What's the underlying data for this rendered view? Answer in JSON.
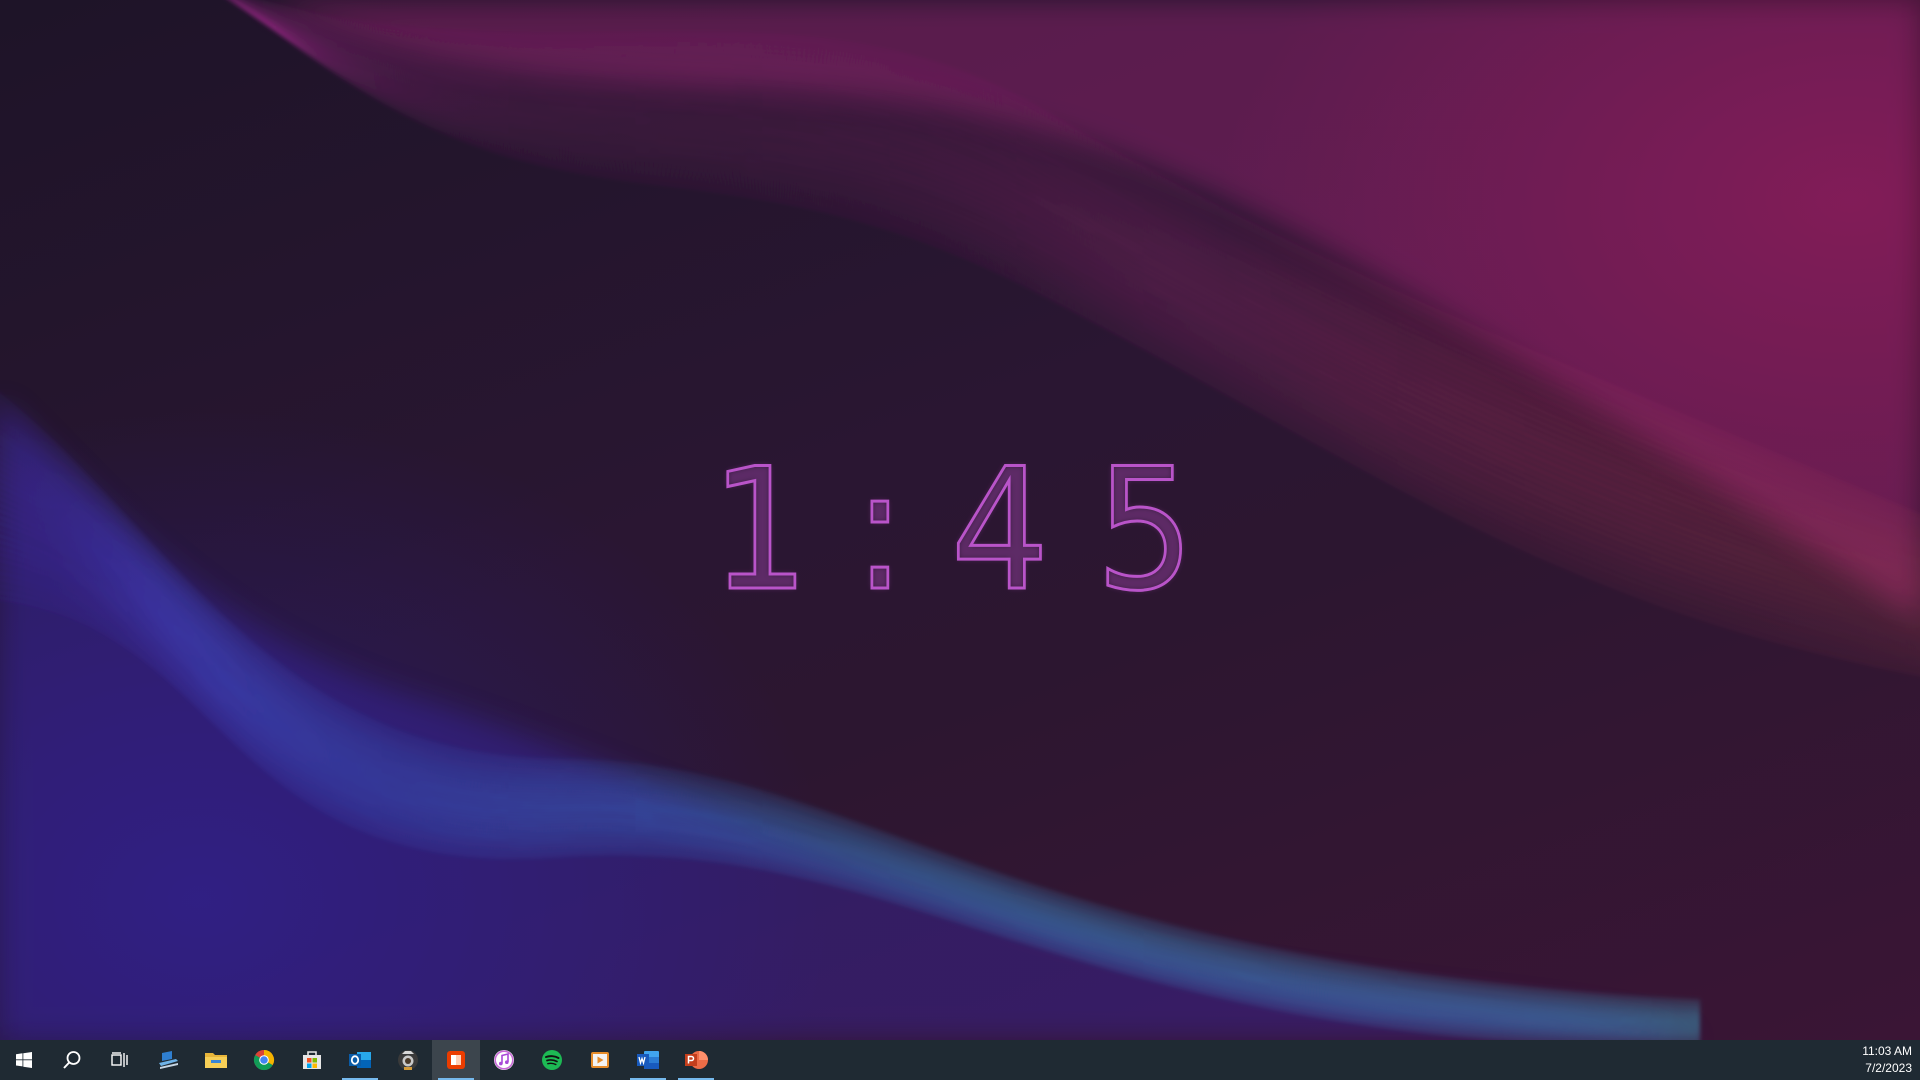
{
  "screen": {
    "clock": {
      "h": "1",
      "sep": ":",
      "m1": "4",
      "m2": "5"
    }
  },
  "colors": {
    "clock": "#c65ad6",
    "taskbar": "#1f2a33",
    "active_indicator": "#76b9ed"
  },
  "taskbar": {
    "items": [
      {
        "name": "start",
        "icon": "windows-logo-icon"
      },
      {
        "name": "search",
        "icon": "search-icon"
      },
      {
        "name": "task-view",
        "icon": "task-view-icon"
      },
      {
        "name": "app-1",
        "icon": "desk-app-icon"
      },
      {
        "name": "file-explorer",
        "icon": "folder-icon"
      },
      {
        "name": "chrome",
        "icon": "chrome-icon"
      },
      {
        "name": "store",
        "icon": "store-icon"
      },
      {
        "name": "outlook",
        "icon": "outlook-icon",
        "active": true
      },
      {
        "name": "camera-app",
        "icon": "camera-icon"
      },
      {
        "name": "office",
        "icon": "office-icon",
        "selected": true
      },
      {
        "name": "itunes",
        "icon": "music-note-icon"
      },
      {
        "name": "spotify",
        "icon": "spotify-icon"
      },
      {
        "name": "media-player",
        "icon": "play-icon"
      },
      {
        "name": "word",
        "icon": "word-icon",
        "active": true
      },
      {
        "name": "powerpoint",
        "icon": "powerpoint-icon",
        "active": true
      }
    ]
  },
  "tray": {
    "time": "11:03 AM",
    "date": "7/2/2023"
  }
}
